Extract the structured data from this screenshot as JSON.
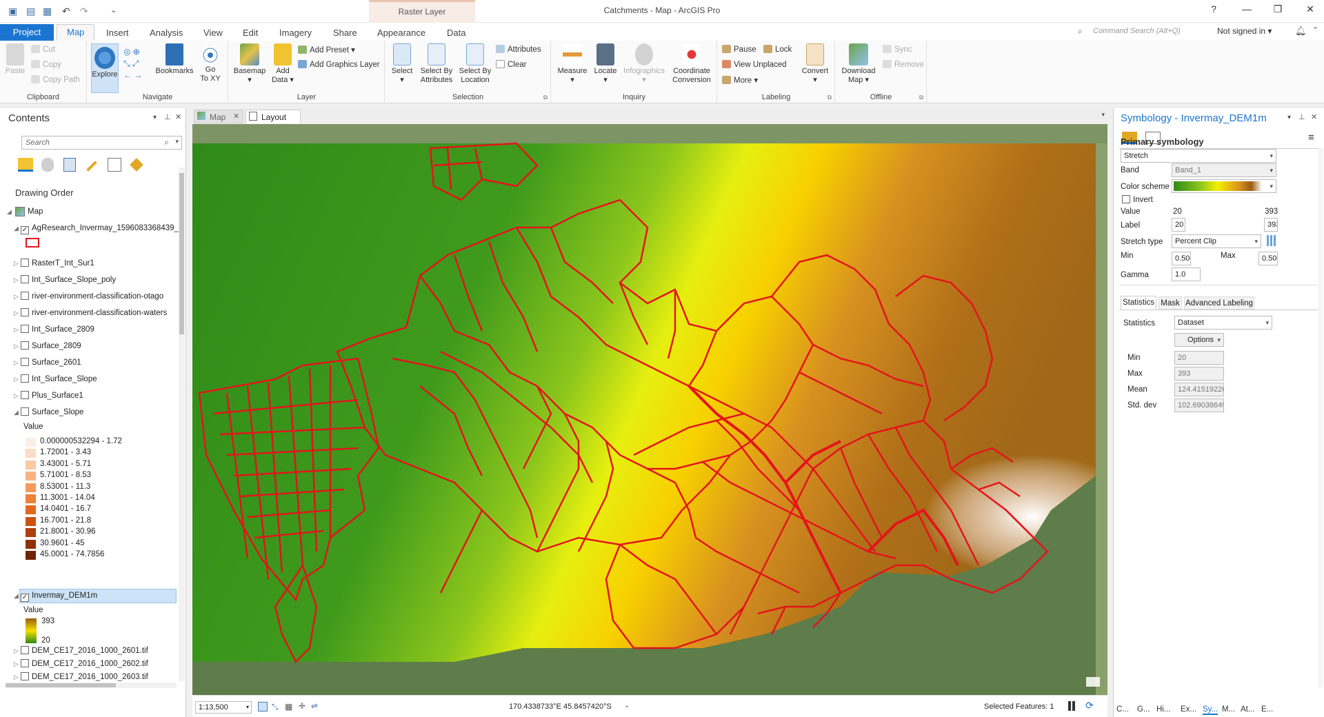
{
  "title_bar": {
    "app_title": "Catchments - Map - ArcGIS Pro",
    "contextual_group": "Raster Layer",
    "help": "?",
    "minimize": "—",
    "maximize": "❐",
    "close": "✕"
  },
  "tabs": [
    "Project",
    "Map",
    "Insert",
    "Analysis",
    "View",
    "Edit",
    "Imagery",
    "Share",
    "Appearance",
    "Data"
  ],
  "command_search": {
    "placeholder": "Command Search (Alt+Q)"
  },
  "sign_in": "Not signed in ▾",
  "ribbon": {
    "clipboard": {
      "label": "Clipboard",
      "paste": "Paste",
      "cut": "Cut",
      "copy": "Copy",
      "copy_path": "Copy Path"
    },
    "navigate": {
      "label": "Navigate",
      "explore": "Explore",
      "bookmarks": "Bookmarks",
      "go_to_xy_1": "Go",
      "go_to_xy_2": "To XY"
    },
    "layer": {
      "label": "Layer",
      "basemap": "Basemap",
      "add_data_1": "Add",
      "add_data_2": "Data",
      "add_preset": "Add Preset ▾",
      "add_graphics_layer": "Add Graphics Layer"
    },
    "selection": {
      "label": "Selection",
      "select": "Select",
      "select_by_attributes_1": "Select By",
      "select_by_attributes_2": "Attributes",
      "select_by_location_1": "Select By",
      "select_by_location_2": "Location",
      "attributes": "Attributes",
      "clear": "Clear"
    },
    "inquiry": {
      "label": "Inquiry",
      "measure": "Measure",
      "locate": "Locate",
      "infographics": "Infographics",
      "coordinate_conversion_1": "Coordinate",
      "coordinate_conversion_2": "Conversion"
    },
    "labeling": {
      "label": "Labeling",
      "pause": "Pause",
      "lock": "Lock",
      "view_unplaced": "View Unplaced",
      "more": "More ▾",
      "convert": "Convert"
    },
    "offline": {
      "label": "Offline",
      "download_map_1": "Download",
      "download_map_2": "Map ▾",
      "sync": "Sync",
      "remove": "Remove"
    }
  },
  "contents": {
    "title": "Contents",
    "search_placeholder": "Search",
    "drawing_order": "Drawing Order",
    "map_label": "Map",
    "layers": [
      "AgResearch_Invermay_1596083368439_",
      "RasterT_Int_Sur1",
      "Int_Surface_Slope_poly",
      "river-environment-classification-otago",
      "river-environment-classification-waters",
      "Int_Surface_2809",
      "Surface_2809",
      "Surface_2601",
      "Int_Surface_Slope",
      "Plus_Surface1",
      "Surface_Slope"
    ],
    "slope_value_label": "Value",
    "slope_classes": [
      {
        "label": "0.000000532294 - 1.72",
        "color": "#fdeee4"
      },
      {
        "label": "1.72001 - 3.43",
        "color": "#fcdcc4"
      },
      {
        "label": "3.43001 - 5.71",
        "color": "#fbc9a3"
      },
      {
        "label": "5.71001 - 8.53",
        "color": "#f8b380"
      },
      {
        "label": "8.53001 - 11.3",
        "color": "#f59a5c"
      },
      {
        "label": "11.3001 - 14.04",
        "color": "#ee8139"
      },
      {
        "label": "14.0401 - 16.7",
        "color": "#e2691d"
      },
      {
        "label": "16.7001 - 21.8",
        "color": "#cc5210"
      },
      {
        "label": "21.8001 - 30.96",
        "color": "#ad400b"
      },
      {
        "label": "30.9601 - 45",
        "color": "#8f3208"
      },
      {
        "label": "45.0001 - 74.7856",
        "color": "#702606"
      }
    ],
    "dem_layer": "Invermay_DEM1m",
    "dem_value_label": "Value",
    "dem_max": "393",
    "dem_min": "20",
    "more_layers": [
      "DEM_CE17_2016_1000_2601.tif",
      "DEM_CE17_2016_1000_2602.tif",
      "DEM_CE17_2016_1000_2603.tif"
    ]
  },
  "view_tabs": {
    "map": "Map",
    "layout": "Layout"
  },
  "status": {
    "scale": "1:13,500",
    "coordinates": "170.4338733°E 45.8457420°S",
    "selected_features": "Selected Features: 1"
  },
  "symbology": {
    "title": "Symbology - Invermay_DEM1m",
    "primary_symbology": "Primary symbology",
    "renderer": "Stretch",
    "band_label": "Band",
    "band_value": "Band_1",
    "color_scheme_label": "Color scheme",
    "invert_label": "Invert",
    "value_label": "Value",
    "value_min": "20",
    "value_max": "393",
    "label_label": "Label",
    "label_min": "20",
    "label_max": "393",
    "stretch_type_label": "Stretch type",
    "stretch_type": "Percent Clip",
    "min_label": "Min",
    "min_value": "0.500",
    "max_label": "Max",
    "max_value": "0.500",
    "gamma_label": "Gamma",
    "gamma_value": "1.0",
    "subtabs": [
      "Statistics",
      "Mask",
      "Advanced Labeling"
    ],
    "statistics_label": "Statistics",
    "statistics_value": "Dataset",
    "options_button": "Options",
    "stats": [
      {
        "label": "Min",
        "value": "20"
      },
      {
        "label": "Max",
        "value": "393"
      },
      {
        "label": "Mean",
        "value": "124.41519226"
      },
      {
        "label": "Std. dev",
        "value": "102.69038649"
      }
    ],
    "bottom_tabs": [
      "C...",
      "G...",
      "Hi...",
      "Ex...",
      "Sy...",
      "M...",
      "At...",
      "E..."
    ]
  },
  "colors": {
    "accent": "#1b75d0",
    "polygon_stroke": "#e4141b",
    "dem_low": "#2f8a18",
    "dem_mid": "#f4f000",
    "dem_high": "#9a5c10"
  }
}
